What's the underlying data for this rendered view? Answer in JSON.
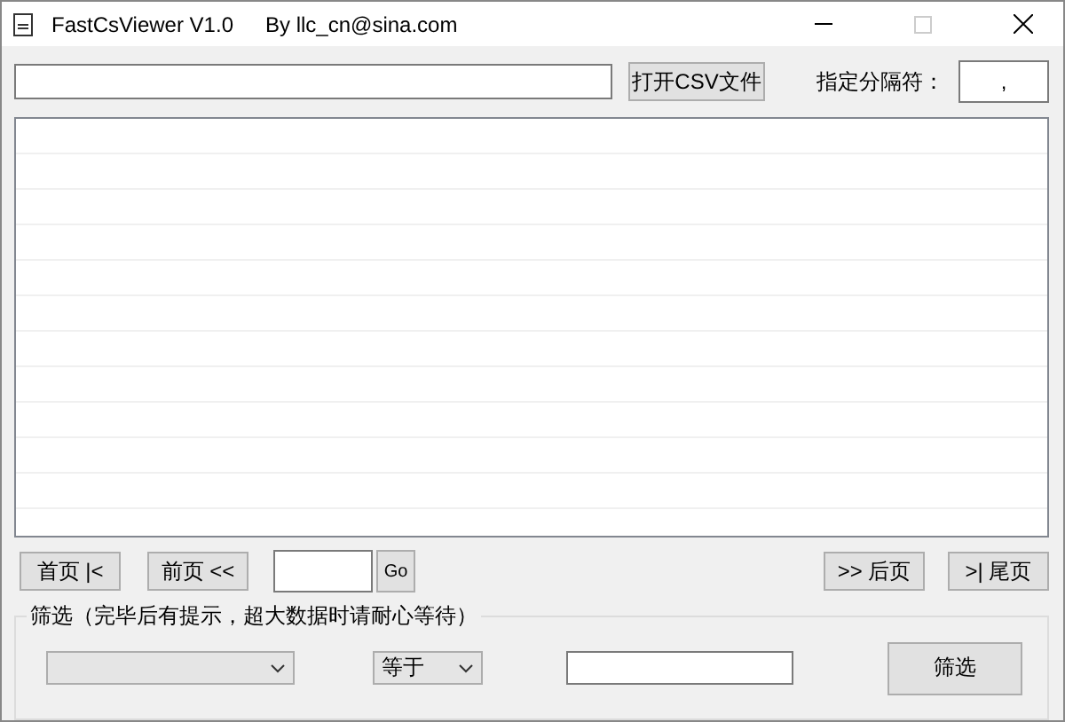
{
  "window": {
    "title": "FastCsViewer V1.0",
    "author": "By llc_cn@sina.com"
  },
  "toolbar": {
    "open_button": "打开CSV文件",
    "delimiter_label": "指定分隔符：",
    "delimiter_value": ","
  },
  "pager": {
    "first": "首页 |<",
    "prev": "前页 <<",
    "go": "Go",
    "next": ">> 后页",
    "last": ">| 尾页"
  },
  "filter": {
    "legend": "筛选（完毕后有提示，超大数据时请耐心等待）",
    "operator": "等于",
    "button": "筛选"
  }
}
